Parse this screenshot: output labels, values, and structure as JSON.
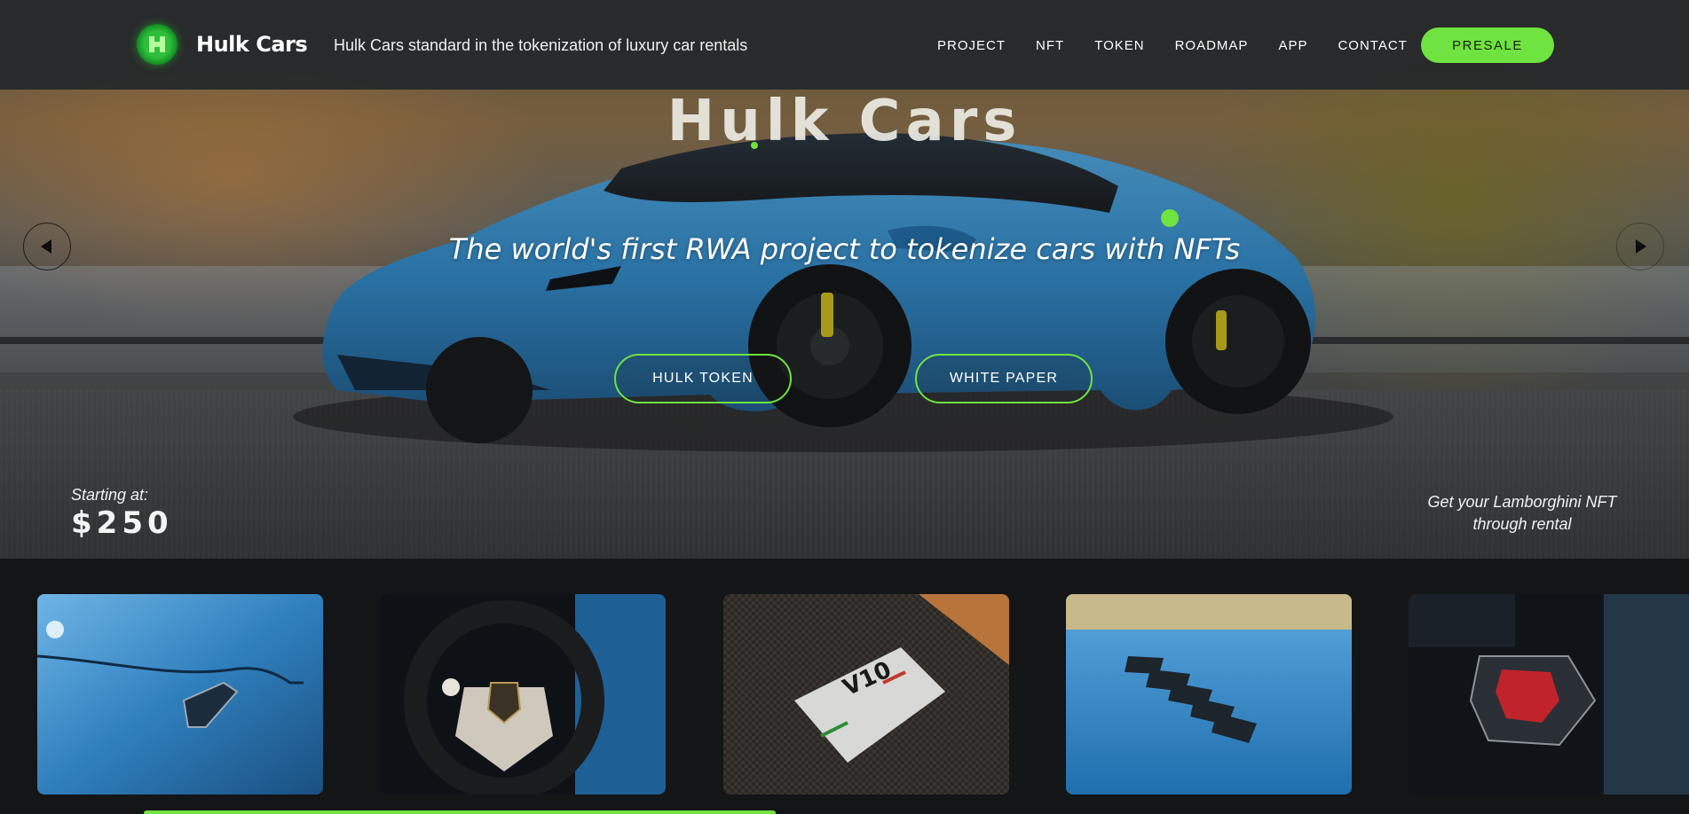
{
  "nav": {
    "brand": "Hulk Cars",
    "tagline": "Hulk Cars standard in the tokenization of luxury car rentals",
    "links": [
      "PROJECT",
      "NFT",
      "TOKEN",
      "ROADMAP",
      "APP",
      "CONTACT"
    ],
    "presale_label": "PRESALE"
  },
  "hero": {
    "title": "Hulk Cars",
    "subtitle": "The world's first RWA project to tokenize cars with NFTs",
    "buttons": {
      "token": "HULK TOKEN",
      "paper": "WHITE PAPER"
    },
    "starting_label": "Starting at:",
    "price": "$250",
    "nft_text": "Get your Lamborghini NFT through rental"
  },
  "gallery": {
    "images": [
      "lamborghini-hood-badge",
      "lamborghini-steering-wheel",
      "v10-engine-plate",
      "hood-vents",
      "start-button-console"
    ]
  },
  "colors": {
    "accent": "#6fe33f",
    "nav_bg": "#24272a",
    "page_bg": "#141517",
    "car_blue": "#2f86c4"
  }
}
